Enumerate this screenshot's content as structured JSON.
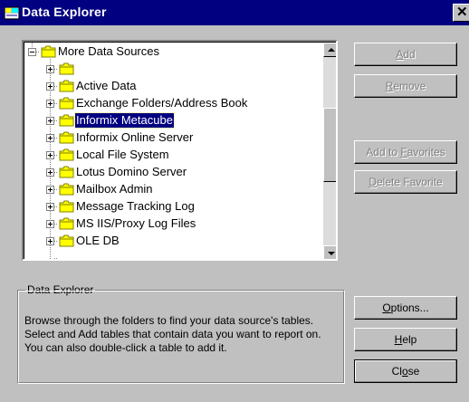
{
  "window": {
    "title": "Data Explorer",
    "close_glyph": "✕"
  },
  "tree": {
    "items": [
      {
        "label": "More Data Sources",
        "expanded": true,
        "level": 0
      },
      {
        "label": "",
        "level": 1
      },
      {
        "label": "Active Data",
        "level": 1
      },
      {
        "label": "Exchange Folders/Address Book",
        "level": 1
      },
      {
        "label": "Informix Metacube",
        "level": 1,
        "selected": true
      },
      {
        "label": "Informix Online Server",
        "level": 1
      },
      {
        "label": "Local File System",
        "level": 1
      },
      {
        "label": "Lotus Domino Server",
        "level": 1
      },
      {
        "label": "Mailbox Admin",
        "level": 1
      },
      {
        "label": "Message Tracking Log",
        "level": 1
      },
      {
        "label": "MS IIS/Proxy Log Files",
        "level": 1
      },
      {
        "label": "OLE DB",
        "level": 1
      }
    ]
  },
  "buttons": {
    "add": {
      "pre": "",
      "key": "A",
      "post": "dd",
      "enabled": false
    },
    "remove": {
      "pre": "",
      "key": "R",
      "post": "emove",
      "enabled": false
    },
    "add_to_favorites": {
      "pre": "Add to ",
      "key": "F",
      "post": "avorites",
      "enabled": false
    },
    "delete_favorite": {
      "pre": "",
      "key": "D",
      "post": "elete Favorite",
      "enabled": false
    },
    "options": {
      "pre": "",
      "key": "O",
      "post": "ptions...",
      "enabled": true
    },
    "help": {
      "pre": "",
      "key": "H",
      "post": "elp",
      "enabled": true
    },
    "close": {
      "pre": "Cl",
      "key": "o",
      "post": "se",
      "enabled": true
    }
  },
  "info": {
    "legend": "Data Explorer",
    "description": "Browse through the folders to find your data source's tables.  Select and Add tables that contain data you want to report on.  You can also double-click a table to add it."
  },
  "colors": {
    "titlebar": "#000080",
    "face": "#c0c0c0",
    "selection": "#000080",
    "folder": "#ffff00"
  }
}
